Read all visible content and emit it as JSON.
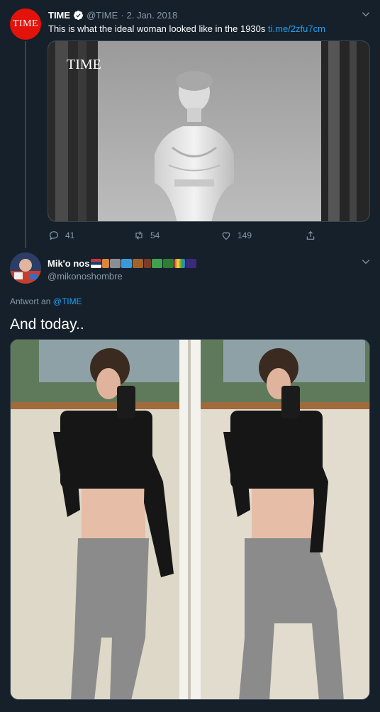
{
  "original_tweet": {
    "avatar_text": "TIME",
    "display_name": "TIME",
    "handle": "@TIME",
    "separator": "·",
    "date": "2. Jan. 2018",
    "text": "This is what the ideal woman looked like in the 1930s",
    "link": "ti.me/2zfu7cm",
    "media": {
      "watermark": "TIME",
      "description_icon": "statue-photo"
    },
    "counts": {
      "replies": "41",
      "retweets": "54",
      "likes": "149"
    }
  },
  "reply_tweet": {
    "display_name": "Mik'o nos",
    "emoji_icons": [
      "serbia-flag",
      "person-running",
      "moai",
      "swimmer",
      "horse-racing",
      "footprints",
      "shamrock",
      "tree",
      "rainbow",
      "milky-way"
    ],
    "handle": "@mikonoshombre",
    "reply_prefix": "Antwort an",
    "reply_mention": "@TIME",
    "text": "And today..",
    "media": {
      "description_icon": "mirror-selfie-photo"
    }
  },
  "colors": {
    "background": "#15202b",
    "accent": "#1da1f2",
    "muted": "#8899a6",
    "time_red": "#e3120b",
    "border": "#38444d"
  }
}
